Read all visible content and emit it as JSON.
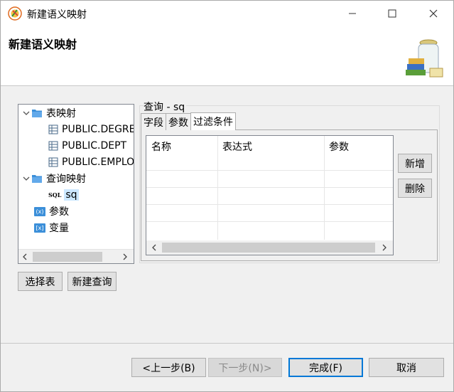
{
  "window": {
    "title": "新建语义映射",
    "minimize_icon": "minimize-icon",
    "maximize_icon": "maximize-icon",
    "close_icon": "close-icon"
  },
  "header": {
    "title": "新建语义映射",
    "image": "jar-books-icon"
  },
  "tree": {
    "items": [
      {
        "label": "表映射",
        "icon": "folder-icon",
        "expanded": true
      },
      {
        "label": "PUBLIC.DEGRE",
        "icon": "table-icon"
      },
      {
        "label": "PUBLIC.DEPT",
        "icon": "table-icon"
      },
      {
        "label": "PUBLIC.EMPLO",
        "icon": "table-icon"
      },
      {
        "label": "查询映射",
        "icon": "folder-icon",
        "expanded": true
      },
      {
        "label": "sq",
        "icon": "sql-icon",
        "icon_text": "SQL",
        "selected": true
      },
      {
        "label": "参数",
        "icon": "param-folder-icon",
        "icon_text": "(x)"
      },
      {
        "label": "变量",
        "icon": "var-folder-icon",
        "icon_text": "[x]"
      }
    ]
  },
  "left_buttons": {
    "select_table": "选择表",
    "new_query": "新建查询"
  },
  "query": {
    "title": "查询 - sq",
    "tabs": [
      "字段",
      "参数",
      "过滤条件"
    ],
    "active_tab": "过滤条件",
    "columns": [
      "名称",
      "表达式",
      "参数"
    ],
    "add_button": "新增",
    "delete_button": "删除"
  },
  "footer": {
    "prev_button": "<上一步(B)",
    "next_button": "下一步(N)>",
    "finish_button": "完成(F)",
    "cancel_button": "取消"
  },
  "colors": {
    "accent": "#0078d7",
    "selection": "#cce8ff"
  }
}
